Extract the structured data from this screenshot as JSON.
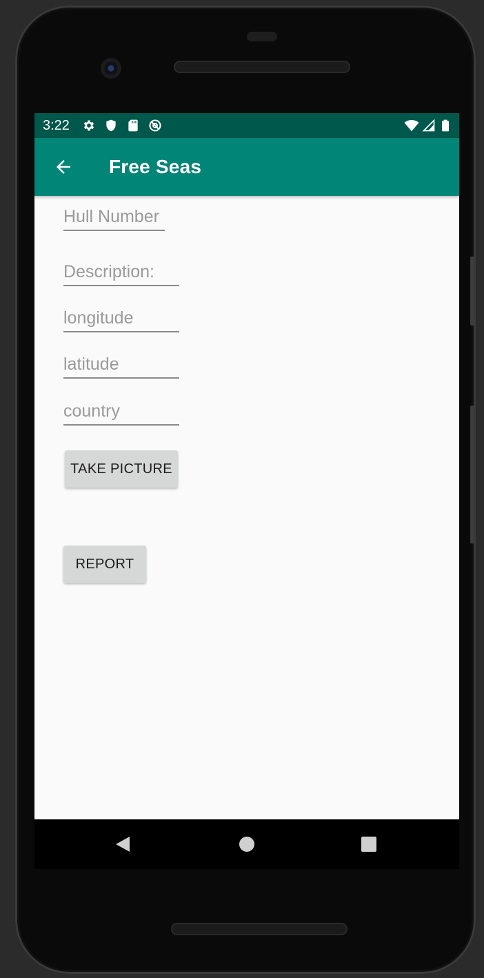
{
  "status_bar": {
    "time": "3:22",
    "left_icons": [
      "gear-icon",
      "shield-icon",
      "sd-card-icon",
      "at-sign-icon"
    ],
    "right_icons": [
      "wifi-icon",
      "cell-signal-icon",
      "battery-icon"
    ],
    "color": "#00574b"
  },
  "app_bar": {
    "title": "Free Seas",
    "color": "#008577"
  },
  "form": {
    "hull_number_placeholder": "Hull Number",
    "description_placeholder": "Description:",
    "longitude_placeholder": "longitude",
    "latitude_placeholder": "latitude",
    "country_placeholder": "country"
  },
  "buttons": {
    "take_picture": "TAKE PICTURE",
    "report": "REPORT"
  },
  "nav_bar": {
    "icons": [
      "back-triangle-icon",
      "home-circle-icon",
      "recents-square-icon"
    ]
  }
}
